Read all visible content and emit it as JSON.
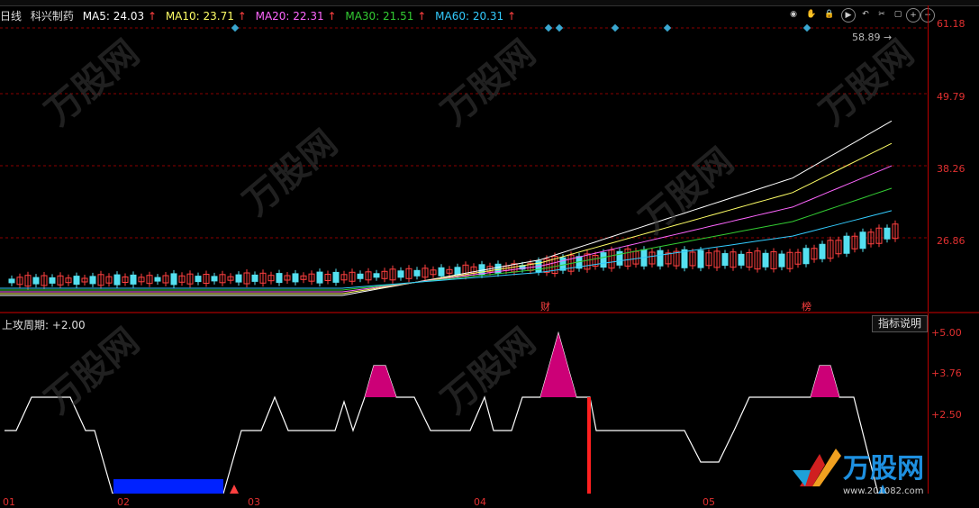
{
  "main": {
    "chart_label": "日线",
    "stock_name": "科兴制药",
    "ma": [
      {
        "label": "MA5: 24.03",
        "color": "#ffffff"
      },
      {
        "label": "MA10: 23.71",
        "color": "#ffff66"
      },
      {
        "label": "MA20: 22.31",
        "color": "#ff66ff"
      },
      {
        "label": "MA30: 21.51",
        "color": "#33cc33"
      },
      {
        "label": "MA60: 20.31",
        "color": "#33ccff"
      }
    ],
    "max_price_label": "58.89",
    "y_ticks": [
      "61.18",
      "49.79",
      "38.26",
      "26.86"
    ],
    "markers": {
      "cai": "财",
      "bang": "榜"
    }
  },
  "toolbar": {
    "icons": [
      "eye-icon",
      "hand-icon",
      "lock-icon",
      "play-icon",
      "undo-icon",
      "scissors-icon",
      "expand-icon",
      "zoom-in-icon",
      "zoom-out-icon"
    ]
  },
  "sub": {
    "title": "上攻周期: +2.00",
    "indicator_button": "指标说明",
    "y_ticks": [
      "+5.00",
      "+3.76",
      "+2.50"
    ]
  },
  "x_axis": [
    "01",
    "02",
    "03",
    "04",
    "05"
  ],
  "watermark": {
    "brand": "万股网",
    "url": "www.201082.com"
  },
  "colors": {
    "up": "#ff4040",
    "down": "#55e0f0",
    "grid": "#8b0000",
    "magenta": "#cc0077",
    "blue": "#0022ff"
  }
}
